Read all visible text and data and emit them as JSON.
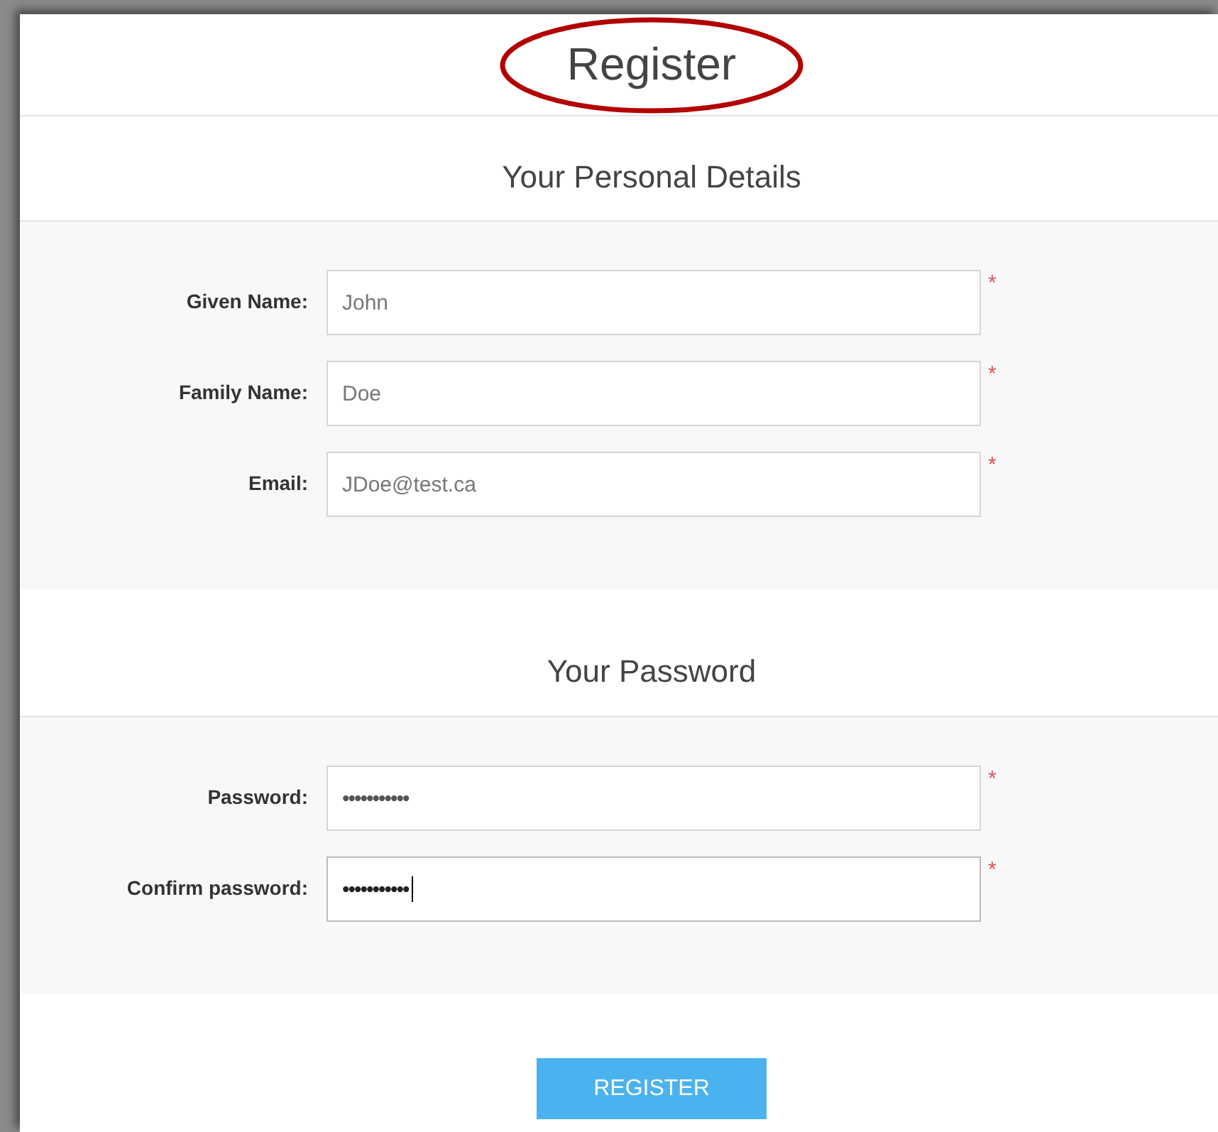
{
  "title": {
    "text": "Register",
    "circled": true
  },
  "sections": [
    {
      "heading": "Your Personal Details",
      "fields": [
        {
          "label": "Given Name:",
          "value": "John",
          "kind": "text",
          "required": true,
          "focused": false
        },
        {
          "label": "Family Name:",
          "value": "Doe",
          "kind": "text",
          "required": true,
          "focused": false
        },
        {
          "label": "Email:",
          "value": "JDoe@test.ca",
          "kind": "text",
          "required": true,
          "focused": false
        }
      ]
    },
    {
      "heading": "Your Password",
      "fields": [
        {
          "label": "Password:",
          "value": "•••••••••••",
          "kind": "password",
          "required": true,
          "focused": false
        },
        {
          "label": "Confirm password:",
          "value": "•••••••••••",
          "kind": "password",
          "required": true,
          "focused": true
        }
      ]
    }
  ],
  "submit": {
    "label": "REGISTER"
  },
  "required_mark": "*"
}
